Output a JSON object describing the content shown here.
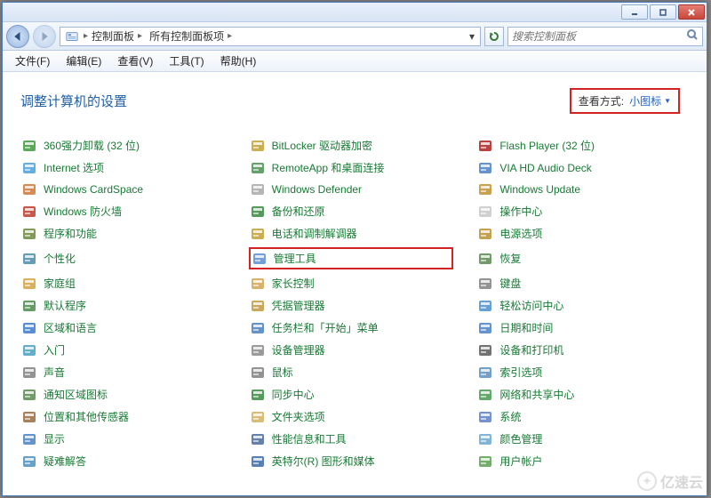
{
  "titlebar": {},
  "nav": {
    "breadcrumb": [
      {
        "label": "控制面板"
      },
      {
        "label": "所有控制面板项"
      }
    ],
    "search_placeholder": "搜索控制面板"
  },
  "menus": [
    {
      "label": "文件(F)"
    },
    {
      "label": "编辑(E)"
    },
    {
      "label": "查看(V)"
    },
    {
      "label": "工具(T)"
    },
    {
      "label": "帮助(H)"
    }
  ],
  "header": {
    "title": "调整计算机的设置",
    "view_label": "查看方式:",
    "view_value": "小图标"
  },
  "columns": [
    [
      {
        "name": "uninstall",
        "label": "360强力卸载 (32 位)",
        "color": "#3b9b3b"
      },
      {
        "name": "internet",
        "label": "Internet 选项",
        "color": "#4aa0dd"
      },
      {
        "name": "cardspace",
        "label": "Windows CardSpace",
        "color": "#d07535"
      },
      {
        "name": "firewall",
        "label": "Windows 防火墙",
        "color": "#c0392b"
      },
      {
        "name": "programs",
        "label": "程序和功能",
        "color": "#6a8a3a"
      },
      {
        "name": "personalize",
        "label": "个性化",
        "color": "#4a8caa"
      },
      {
        "name": "homegroup",
        "label": "家庭组",
        "color": "#d2a240"
      },
      {
        "name": "defaultprog",
        "label": "默认程序",
        "color": "#4a8a4a"
      },
      {
        "name": "region",
        "label": "区域和语言",
        "color": "#3a7acc"
      },
      {
        "name": "getstarted",
        "label": "入门",
        "color": "#4aa0c0"
      },
      {
        "name": "sound",
        "label": "声音",
        "color": "#808080"
      },
      {
        "name": "trayicons",
        "label": "通知区域图标",
        "color": "#5a8a50"
      },
      {
        "name": "location",
        "label": "位置和其他传感器",
        "color": "#9a6a40"
      },
      {
        "name": "display",
        "label": "显示",
        "color": "#4a80c8"
      },
      {
        "name": "troubleshoot",
        "label": "疑难解答",
        "color": "#4a90c0"
      }
    ],
    [
      {
        "name": "bitlocker",
        "label": "BitLocker 驱动器加密",
        "color": "#c2a030"
      },
      {
        "name": "remoteapp",
        "label": "RemoteApp 和桌面连接",
        "color": "#4a9050"
      },
      {
        "name": "defender",
        "label": "Windows Defender",
        "color": "#a8a8a8"
      },
      {
        "name": "backup",
        "label": "备份和还原",
        "color": "#3a8a40"
      },
      {
        "name": "phone",
        "label": "电话和调制解调器",
        "color": "#c2a030"
      },
      {
        "name": "admintools",
        "label": "管理工具",
        "highlight": true,
        "color": "#5a90d0"
      },
      {
        "name": "parental",
        "label": "家长控制",
        "color": "#d2a450"
      },
      {
        "name": "credentials",
        "label": "凭据管理器",
        "color": "#c29a40"
      },
      {
        "name": "taskbar",
        "label": "任务栏和「开始」菜单",
        "color": "#4a80c0"
      },
      {
        "name": "devicemgr",
        "label": "设备管理器",
        "color": "#8a8a8a"
      },
      {
        "name": "mouse",
        "label": "鼠标",
        "color": "#808080"
      },
      {
        "name": "synccenter",
        "label": "同步中心",
        "color": "#3a8a40"
      },
      {
        "name": "folderopt",
        "label": "文件夹选项",
        "color": "#d2b060"
      },
      {
        "name": "perfinfo",
        "label": "性能信息和工具",
        "color": "#4a6a9a"
      },
      {
        "name": "intelgfx",
        "label": "英特尔(R) 图形和媒体",
        "color": "#3a6aaa"
      }
    ],
    [
      {
        "name": "flash",
        "label": "Flash Player (32 位)",
        "color": "#b02020"
      },
      {
        "name": "viahd",
        "label": "VIA HD Audio Deck",
        "color": "#4a80c8"
      },
      {
        "name": "winupdate",
        "label": "Windows Update",
        "color": "#c29030"
      },
      {
        "name": "actioncenter",
        "label": "操作中心",
        "color": "#c8c8c8"
      },
      {
        "name": "power",
        "label": "电源选项",
        "color": "#b89030"
      },
      {
        "name": "recovery",
        "label": "恢复",
        "color": "#5a8a50"
      },
      {
        "name": "keyboard",
        "label": "键盘",
        "color": "#808080"
      },
      {
        "name": "easeaccess",
        "label": "轻松访问中心",
        "color": "#4a90d0"
      },
      {
        "name": "datetime",
        "label": "日期和时间",
        "color": "#4a80c8"
      },
      {
        "name": "devprinters",
        "label": "设备和打印机",
        "color": "#5a5a5a"
      },
      {
        "name": "indexing",
        "label": "索引选项",
        "color": "#5a90c0"
      },
      {
        "name": "network",
        "label": "网络和共享中心",
        "color": "#4a9a50"
      },
      {
        "name": "system",
        "label": "系统",
        "color": "#5a80c8"
      },
      {
        "name": "colormgmt",
        "label": "颜色管理",
        "color": "#6aa8d0"
      },
      {
        "name": "useraccts",
        "label": "用户帐户",
        "color": "#5aa050"
      }
    ]
  ],
  "watermark": "亿速云"
}
